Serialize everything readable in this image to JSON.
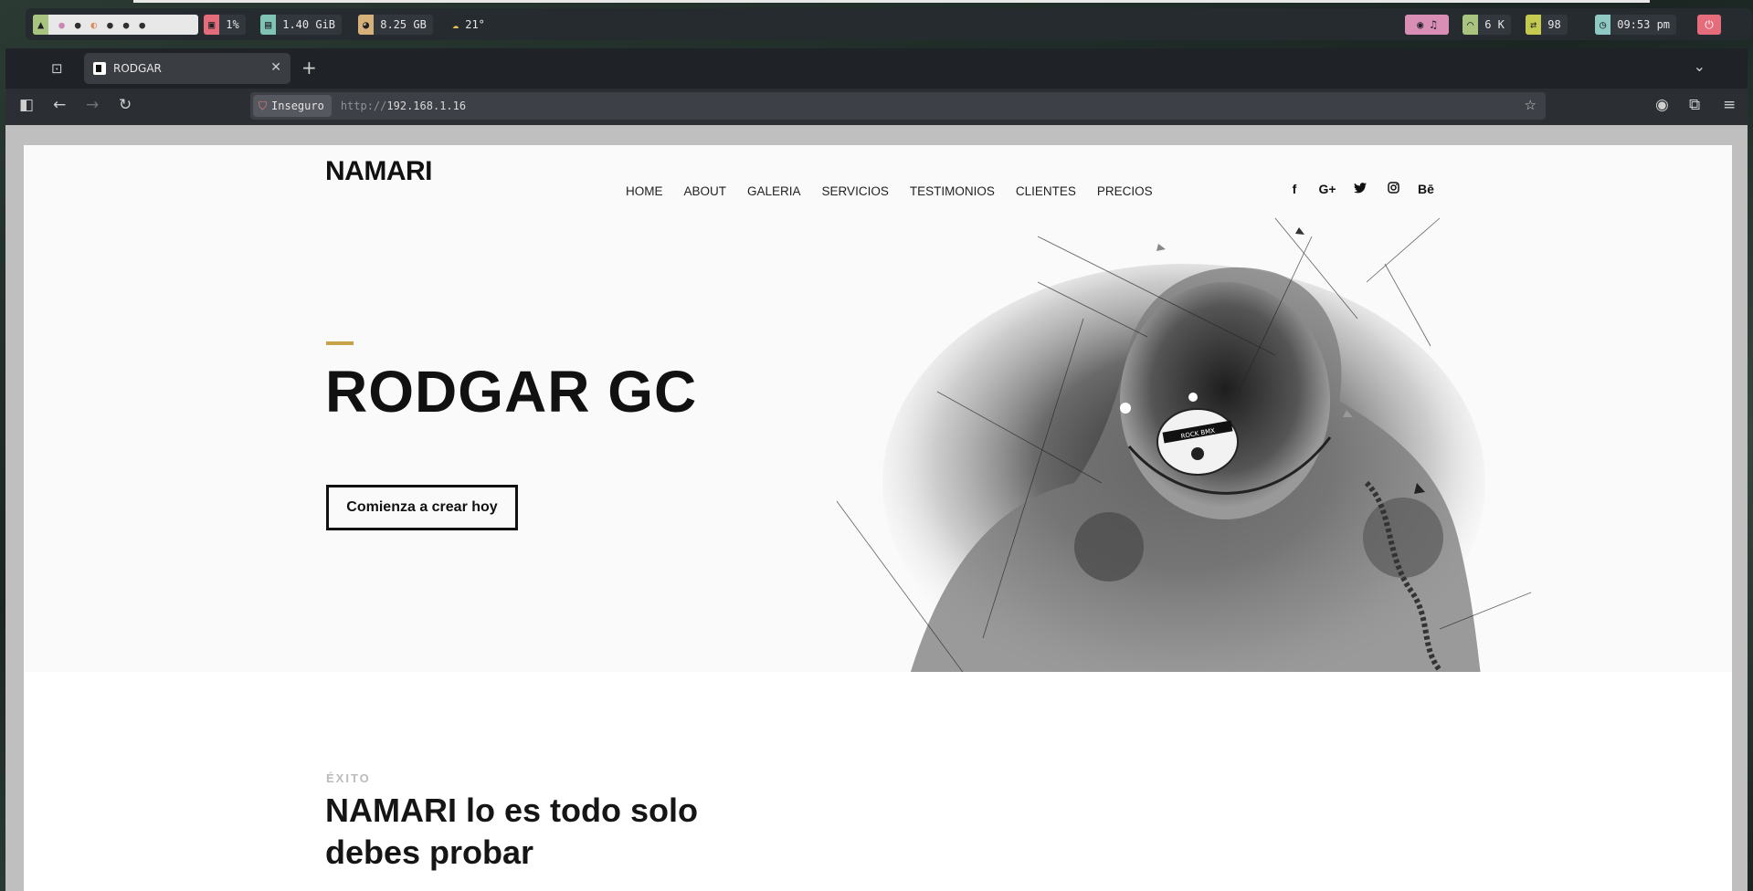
{
  "topbar": {
    "cpu": "1%",
    "ram": "1.40 GiB",
    "disk": "8.25 GB",
    "weather": "21°",
    "network": "6 K",
    "updates": "98",
    "clock": "09:53 pm"
  },
  "browser": {
    "tab_title": "RODGAR",
    "insecure_label": "Inseguro",
    "url_scheme": "http://",
    "url_host": "192.168.1.16"
  },
  "site": {
    "logo": "NAMARI",
    "menu": [
      "HOME",
      "ABOUT",
      "GALERIA",
      "SERVICIOS",
      "TESTIMONIOS",
      "CLIENTES",
      "PRECIOS"
    ],
    "social": [
      "f",
      "G+",
      "twitter",
      "instagram",
      "Bē"
    ],
    "hero_title": "RODGAR GC",
    "cta_label": "Comienza a crear hoy",
    "badge_text": "ROCK BMX",
    "section_kicker": "ÉXITO",
    "section_title": "NAMARI lo es todo solo debes probar"
  },
  "colors": {
    "accent": "#c8a24b",
    "bar_green": "#a9c47f",
    "bar_red": "#e56c7a",
    "bar_teal": "#7fc4b5",
    "bar_tan": "#d6b27a",
    "bar_pink": "#d98fb5",
    "bar_lime": "#c4c94f",
    "bar_cyan": "#8fc9c4"
  }
}
